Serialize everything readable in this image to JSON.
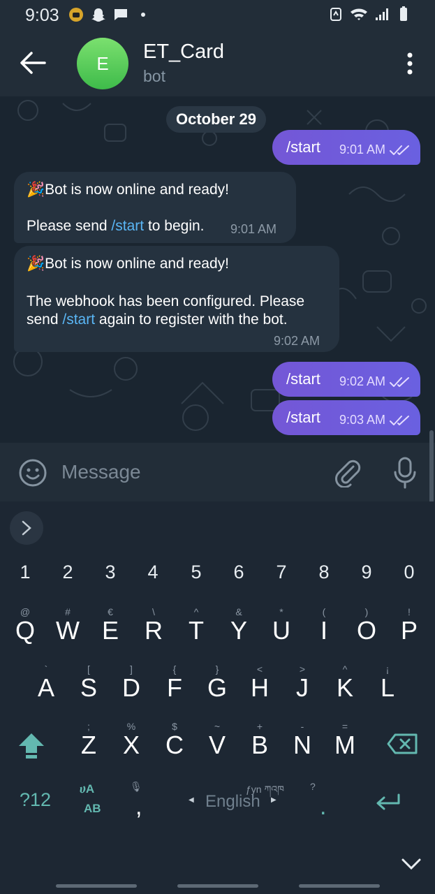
{
  "status_bar": {
    "time": "9:03",
    "left_icons": [
      "gold-app-icon",
      "snapchat-icon",
      "message-icon",
      "dot-icon"
    ],
    "right_icons": [
      "battery-saver-icon",
      "wifi-icon",
      "signal-icon",
      "battery-icon"
    ]
  },
  "header": {
    "avatar_letter": "E",
    "title": "ET_Card",
    "subtitle": "bot",
    "accent": "#4cc356"
  },
  "chat": {
    "date_separator": "October 29",
    "messages": [
      {
        "direction": "out",
        "text": "/start",
        "time": "9:01 AM",
        "status": "read"
      },
      {
        "direction": "in",
        "emoji": "🎉",
        "line1": "Bot is now online and ready!",
        "line2_pre": "Please send ",
        "line2_link": "/start",
        "line2_post": " to begin.",
        "time": "9:01 AM"
      },
      {
        "direction": "in",
        "emoji": "🎉",
        "line1": "Bot is now online and ready!",
        "line2": "The webhook has been configured. Please",
        "line3_pre": "send ",
        "line3_link": "/start",
        "line3_post": " again to register with the bot.",
        "time": "9:02 AM"
      },
      {
        "direction": "out",
        "text": "/start",
        "time": "9:02 AM",
        "status": "read"
      },
      {
        "direction": "out",
        "text": "/start",
        "time": "9:03 AM",
        "status": "read"
      }
    ]
  },
  "input": {
    "placeholder": "Message",
    "value": ""
  },
  "keyboard": {
    "number_row": [
      "1",
      "2",
      "3",
      "4",
      "5",
      "6",
      "7",
      "8",
      "9",
      "0"
    ],
    "row1": [
      {
        "key": "Q",
        "sup": "@"
      },
      {
        "key": "W",
        "sup": "#"
      },
      {
        "key": "E",
        "sup": "€"
      },
      {
        "key": "R",
        "sup": "\\"
      },
      {
        "key": "T",
        "sup": "^"
      },
      {
        "key": "Y",
        "sup": "&"
      },
      {
        "key": "U",
        "sup": "*"
      },
      {
        "key": "I",
        "sup": "("
      },
      {
        "key": "O",
        "sup": ")"
      },
      {
        "key": "P",
        "sup": "!"
      }
    ],
    "row2": [
      {
        "key": "A",
        "sup": "`"
      },
      {
        "key": "S",
        "sup": "["
      },
      {
        "key": "D",
        "sup": "]"
      },
      {
        "key": "F",
        "sup": "{"
      },
      {
        "key": "G",
        "sup": "}"
      },
      {
        "key": "H",
        "sup": "<"
      },
      {
        "key": "J",
        "sup": ">"
      },
      {
        "key": "K",
        "sup": "^"
      },
      {
        "key": "L",
        "sup": "¡"
      }
    ],
    "row3": [
      {
        "key": "Z",
        "sup": ";"
      },
      {
        "key": "X",
        "sup": "%"
      },
      {
        "key": "C",
        "sup": "$"
      },
      {
        "key": "V",
        "sup": "~"
      },
      {
        "key": "B",
        "sup": "+"
      },
      {
        "key": "N",
        "sup": "-"
      },
      {
        "key": "M",
        "sup": "="
      }
    ],
    "symbols_key": "?12",
    "lang_key_top": "ሀA",
    "lang_key_bottom": "AB",
    "comma": ",",
    "comma_hint": "🎙",
    "space_label": "English",
    "space_hint": "ƒyn ཀའཁ",
    "period": ".",
    "period_hint": "?",
    "accent_color": "#63b8b0"
  }
}
